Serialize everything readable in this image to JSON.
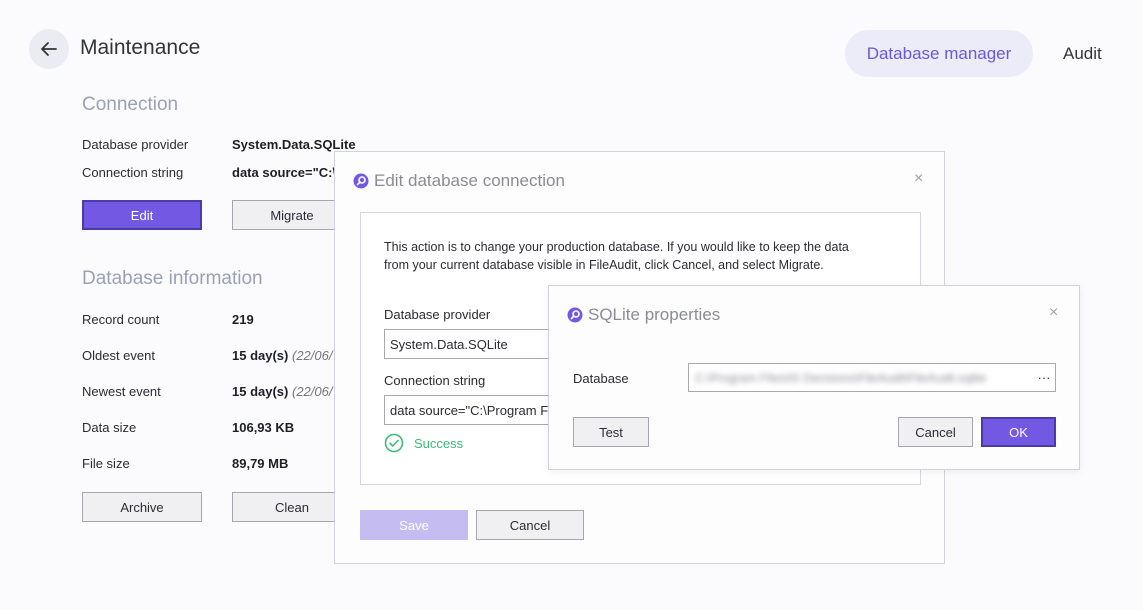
{
  "header": {
    "title": "Maintenance",
    "tabs": [
      {
        "label": "Database manager",
        "active": true
      },
      {
        "label": "Audit",
        "active": false
      }
    ]
  },
  "connection": {
    "section_title": "Connection",
    "provider_label": "Database provider",
    "provider_value": "System.Data.SQLite",
    "conn_label": "Connection string",
    "conn_value": "data source=\"C:\\",
    "edit_label": "Edit",
    "migrate_label": "Migrate"
  },
  "db_info": {
    "section_title": "Database information",
    "rows": [
      {
        "label": "Record count",
        "value": "219",
        "extra": ""
      },
      {
        "label": "Oldest event",
        "value": "15 day(s)",
        "extra": "(22/06/"
      },
      {
        "label": "Newest event",
        "value": "15 day(s)",
        "extra": "(22/06/"
      },
      {
        "label": "Data size",
        "value": "106,93 KB",
        "extra": ""
      },
      {
        "label": "File size",
        "value": "89,79 MB",
        "extra": ""
      }
    ],
    "archive_label": "Archive",
    "clean_label": "Clean"
  },
  "edit_dialog": {
    "title": "Edit database connection",
    "close": "×",
    "message_line1": "This action is to change your production database. If you would like to keep the data",
    "message_line2": "from your current database visible in FileAudit, click Cancel, and select Migrate.",
    "provider_label": "Database provider",
    "provider_value": "System.Data.SQLite",
    "conn_label": "Connection string",
    "conn_value": "data source=\"C:\\Program F",
    "success_text": "Success",
    "save_label": "Save",
    "cancel_label": "Cancel"
  },
  "sqlite_dialog": {
    "title": "SQLite properties",
    "close": "×",
    "database_label": "Database",
    "database_value": "C:\\Program Files\\IS Decisions\\FileAudit\\FileAudit.sqlite",
    "browse_label": "···",
    "test_label": "Test",
    "cancel_label": "Cancel",
    "ok_label": "OK"
  },
  "colors": {
    "accent": "#7258e3",
    "success": "#3cba78",
    "section_title": "#9aa1b5"
  },
  "icons": {
    "back": "arrow-left",
    "dialog": "fileaudit-logo",
    "close": "close",
    "success": "check-circle"
  }
}
